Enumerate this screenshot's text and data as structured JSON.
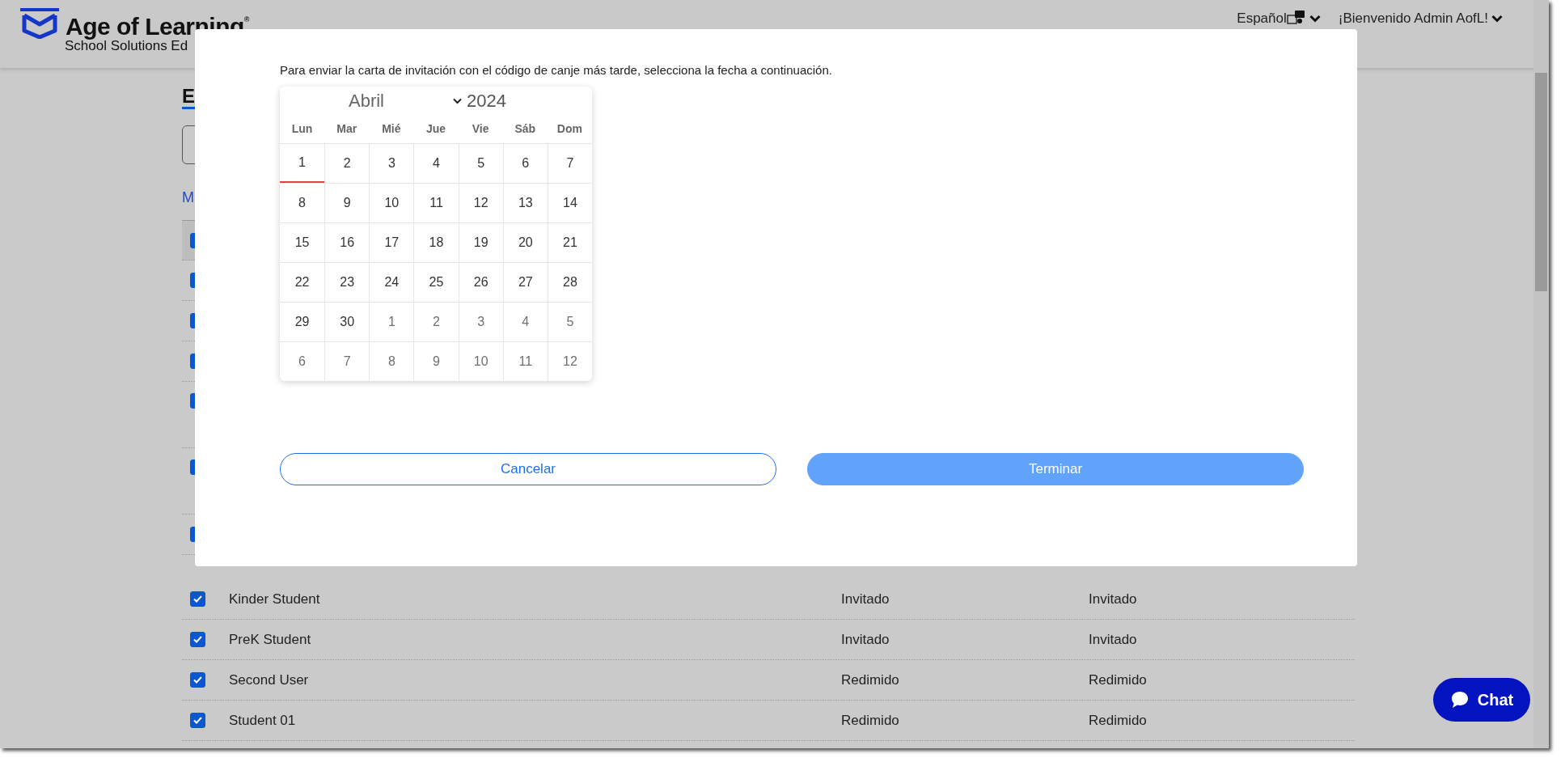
{
  "header": {
    "brand": "Age of Learning$^{®}$",
    "subtitle": "School Solutions Ed",
    "language": "Español",
    "greeting": "¡Bienvenido Admin AofL!"
  },
  "page": {
    "heading": "E",
    "link": "M"
  },
  "hidden_rows": [
    {
      "checked": true
    },
    {
      "checked": true
    },
    {
      "checked": true
    },
    {
      "checked": true
    },
    {
      "checked": true
    },
    {
      "checked": true
    },
    {
      "checked": true
    }
  ],
  "rows": [
    {
      "checked": true,
      "name": "Kinder Student",
      "status_1": "Invitado",
      "status_2": "Invitado"
    },
    {
      "checked": true,
      "name": "PreK Student",
      "status_1": "Invitado",
      "status_2": "Invitado"
    },
    {
      "checked": true,
      "name": "Second User",
      "status_1": "Redimido",
      "status_2": "Redimido"
    },
    {
      "checked": true,
      "name": "Student 01",
      "status_1": "Redimido",
      "status_2": "Redimido"
    }
  ],
  "modal": {
    "message": "Para enviar la carta de invitación con el código de canje más tarde, selecciona la fecha a continuación.",
    "calendar": {
      "month": "Abril",
      "year": "2024",
      "weekdays": [
        "Lun",
        "Mar",
        "Mié",
        "Jue",
        "Vie",
        "Sáb",
        "Dom"
      ],
      "weeks": [
        [
          {
            "day": "1",
            "today": true,
            "muted": false
          },
          {
            "day": "2",
            "today": false,
            "muted": false
          },
          {
            "day": "3",
            "today": false,
            "muted": false
          },
          {
            "day": "4",
            "today": false,
            "muted": false
          },
          {
            "day": "5",
            "today": false,
            "muted": false
          },
          {
            "day": "6",
            "today": false,
            "muted": false
          },
          {
            "day": "7",
            "today": false,
            "muted": false
          }
        ],
        [
          {
            "day": "8",
            "today": false,
            "muted": false
          },
          {
            "day": "9",
            "today": false,
            "muted": false
          },
          {
            "day": "10",
            "today": false,
            "muted": false
          },
          {
            "day": "11",
            "today": false,
            "muted": false
          },
          {
            "day": "12",
            "today": false,
            "muted": false
          },
          {
            "day": "13",
            "today": false,
            "muted": false
          },
          {
            "day": "14",
            "today": false,
            "muted": false
          }
        ],
        [
          {
            "day": "15",
            "today": false,
            "muted": false
          },
          {
            "day": "16",
            "today": false,
            "muted": false
          },
          {
            "day": "17",
            "today": false,
            "muted": false
          },
          {
            "day": "18",
            "today": false,
            "muted": false
          },
          {
            "day": "19",
            "today": false,
            "muted": false
          },
          {
            "day": "20",
            "today": false,
            "muted": false
          },
          {
            "day": "21",
            "today": false,
            "muted": false
          }
        ],
        [
          {
            "day": "22",
            "today": false,
            "muted": false
          },
          {
            "day": "23",
            "today": false,
            "muted": false
          },
          {
            "day": "24",
            "today": false,
            "muted": false
          },
          {
            "day": "25",
            "today": false,
            "muted": false
          },
          {
            "day": "26",
            "today": false,
            "muted": false
          },
          {
            "day": "27",
            "today": false,
            "muted": false
          },
          {
            "day": "28",
            "today": false,
            "muted": false
          }
        ],
        [
          {
            "day": "29",
            "today": false,
            "muted": false
          },
          {
            "day": "30",
            "today": false,
            "muted": false
          },
          {
            "day": "1",
            "today": false,
            "muted": true
          },
          {
            "day": "2",
            "today": false,
            "muted": true
          },
          {
            "day": "3",
            "today": false,
            "muted": true
          },
          {
            "day": "4",
            "today": false,
            "muted": true
          },
          {
            "day": "5",
            "today": false,
            "muted": true
          }
        ],
        [
          {
            "day": "6",
            "today": false,
            "muted": true
          },
          {
            "day": "7",
            "today": false,
            "muted": true
          },
          {
            "day": "8",
            "today": false,
            "muted": true
          },
          {
            "day": "9",
            "today": false,
            "muted": true
          },
          {
            "day": "10",
            "today": false,
            "muted": true
          },
          {
            "day": "11",
            "today": false,
            "muted": true
          },
          {
            "day": "12",
            "today": false,
            "muted": true
          }
        ]
      ]
    },
    "buttons": [
      {
        "label": "Cancelar",
        "kind": "outline"
      },
      {
        "label": "Terminar",
        "kind": "primary"
      }
    ]
  },
  "chat": {
    "label": "Chat"
  }
}
